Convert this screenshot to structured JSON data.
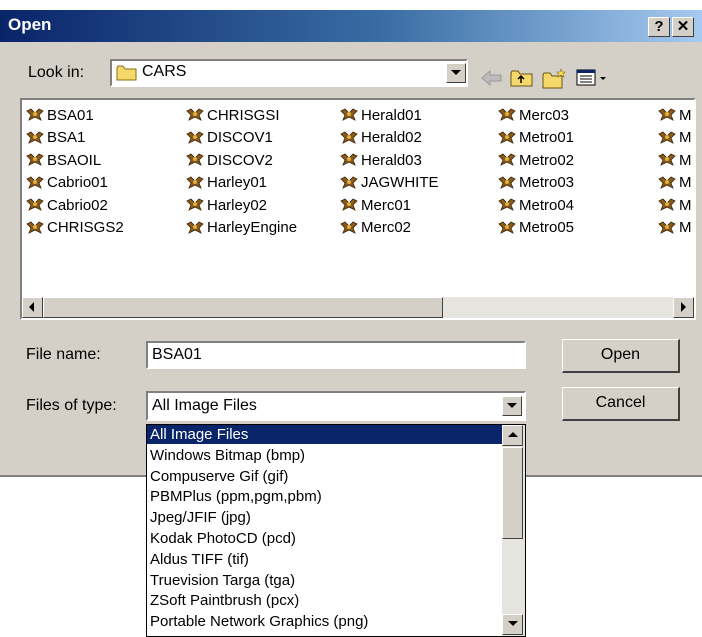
{
  "window": {
    "title": "Open"
  },
  "titlebar": {
    "help_label": "?",
    "close_label": "✕"
  },
  "look_in": {
    "label": "Look in:",
    "value": "CARS"
  },
  "files": {
    "columns": [
      [
        "BSA01",
        "BSA1",
        "BSAOIL",
        "Cabrio01",
        "Cabrio02",
        "CHRISGS2"
      ],
      [
        "CHRISGSI",
        "DISCOV1",
        "DISCOV2",
        "Harley01",
        "Harley02",
        "HarleyEngine"
      ],
      [
        "Herald01",
        "Herald02",
        "Herald03",
        "JAGWHITE",
        "Merc01",
        "Merc02"
      ],
      [
        "Merc03",
        "Metro01",
        "Metro02",
        "Metro03",
        "Metro04",
        "Metro05"
      ],
      [
        "M",
        "M",
        "M",
        "M",
        "M",
        "M"
      ]
    ]
  },
  "file_name": {
    "label": "File name:",
    "value": "BSA01"
  },
  "file_type": {
    "label": "Files of type:",
    "value": "All Image Files",
    "options": [
      "All Image Files",
      "Windows Bitmap (bmp)",
      "Compuserve Gif (gif)",
      "PBMPlus (ppm,pgm,pbm)",
      "Jpeg/JFIF (jpg)",
      "Kodak PhotoCD (pcd)",
      "Aldus TIFF (tif)",
      "Truevision Targa (tga)",
      "ZSoft Paintbrush (pcx)",
      "Portable Network Graphics (png)"
    ],
    "selected_index": 0
  },
  "buttons": {
    "open": "Open",
    "cancel": "Cancel"
  },
  "colors": {
    "title_bar": "#0a246a",
    "dialog_face": "#d4d0c8",
    "selection": "#0a246a"
  }
}
